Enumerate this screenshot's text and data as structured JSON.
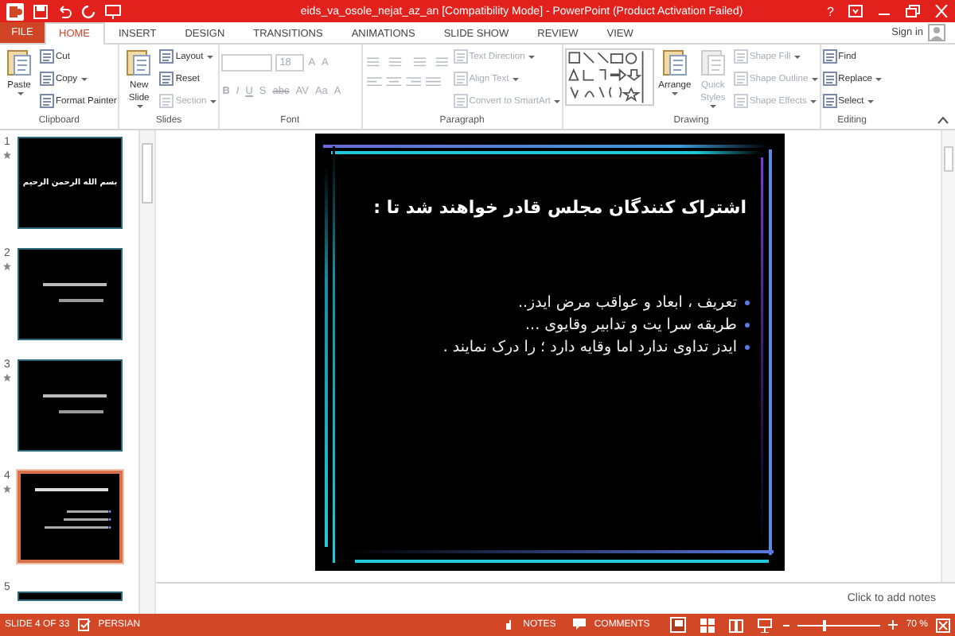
{
  "window": {
    "title": "eids_va_osole_nejat_az_an [Compatibility Mode] - PowerPoint (Product Activation Failed)",
    "help": "?"
  },
  "tabs": [
    {
      "label": "FILE",
      "kind": "file",
      "selected": false
    },
    {
      "label": "HOME",
      "kind": "tab",
      "selected": true
    },
    {
      "label": "INSERT",
      "kind": "tab",
      "selected": false
    },
    {
      "label": "DESIGN",
      "kind": "tab",
      "selected": false
    },
    {
      "label": "TRANSITIONS",
      "kind": "tab",
      "selected": false
    },
    {
      "label": "ANIMATIONS",
      "kind": "tab",
      "selected": false
    },
    {
      "label": "SLIDE SHOW",
      "kind": "tab",
      "selected": false
    },
    {
      "label": "REVIEW",
      "kind": "tab",
      "selected": false
    },
    {
      "label": "VIEW",
      "kind": "tab",
      "selected": false
    }
  ],
  "sign_in": "Sign in",
  "ribbon": [
    {
      "label": "Clipboard",
      "cols": [
        [
          {
            "kind": "large",
            "label": "Paste",
            "caret": true,
            "disabled": false
          }
        ],
        [
          {
            "kind": "small",
            "label": "Cut",
            "caret": false,
            "disabled": false
          },
          {
            "kind": "small",
            "label": "Copy",
            "caret": true,
            "disabled": false
          },
          {
            "kind": "small",
            "label": "Format Painter",
            "caret": false,
            "disabled": false
          }
        ]
      ]
    },
    {
      "label": "Slides",
      "cols": [
        [
          {
            "kind": "large",
            "label": "New Slide",
            "caret": true,
            "disabled": false
          }
        ],
        [
          {
            "kind": "small",
            "label": "Layout",
            "caret": true,
            "disabled": false
          },
          {
            "kind": "small",
            "label": "Reset",
            "caret": false,
            "disabled": false
          },
          {
            "kind": "small",
            "label": "Section",
            "caret": true,
            "disabled": true
          }
        ]
      ]
    },
    {
      "label": "Font",
      "cols": [
        [
          {
            "kind": "fields",
            "size": "18",
            "glyphs": [
              "A",
              "A"
            ],
            "disabled": true
          },
          {
            "kind": "glyphs",
            "glyphs": [
              "B",
              "I",
              "U",
              "S",
              "abc",
              "AV",
              "Aa",
              "A"
            ],
            "disabled": true
          }
        ]
      ]
    },
    {
      "label": "Paragraph",
      "cols": [
        [
          {
            "kind": "tools",
            "disabled": true
          }
        ],
        [
          {
            "kind": "small",
            "label": "Text Direction",
            "caret": true,
            "disabled": true
          },
          {
            "kind": "small",
            "label": "Align Text",
            "caret": true,
            "disabled": true
          },
          {
            "kind": "small",
            "label": "Convert to SmartArt",
            "caret": true,
            "disabled": true
          }
        ]
      ]
    },
    {
      "label": "Drawing",
      "cols": [
        [
          {
            "kind": "gallery"
          }
        ],
        [
          {
            "kind": "large",
            "label": "Arrange",
            "caret": true,
            "disabled": false
          }
        ],
        [
          {
            "kind": "large",
            "label": "Quick Styles",
            "caret": true,
            "disabled": true
          }
        ],
        [
          {
            "kind": "small",
            "label": "Shape Fill",
            "caret": true,
            "disabled": true
          },
          {
            "kind": "small",
            "label": "Shape Outline",
            "caret": true,
            "disabled": true
          },
          {
            "kind": "small",
            "label": "Shape Effects",
            "caret": true,
            "disabled": true
          }
        ]
      ]
    },
    {
      "label": "Editing",
      "cols": [
        [
          {
            "kind": "small",
            "label": "Find",
            "caret": false,
            "disabled": false
          },
          {
            "kind": "small",
            "label": "Replace",
            "caret": true,
            "disabled": false
          },
          {
            "kind": "small",
            "label": "Select",
            "caret": true,
            "disabled": false
          }
        ]
      ]
    }
  ],
  "thumbnails": [
    {
      "number": "1",
      "kind": "text",
      "selected": false,
      "lines": [
        "بسم الله الرحمن الرحيم"
      ]
    },
    {
      "number": "2",
      "kind": "blurred",
      "selected": false
    },
    {
      "number": "3",
      "kind": "blurred",
      "selected": false
    },
    {
      "number": "4",
      "kind": "slide",
      "selected": true
    },
    {
      "number": "5",
      "kind": "cut",
      "selected": false
    }
  ],
  "slide": {
    "title": "اشتراک کنندگان مجلس قادر خواهند شد تا :",
    "bullets": [
      "تعریف ، ابعاد و عواقب مرض ایدز..",
      "طریقه سرا یت و تدابیر وقایوی ...",
      "ایدز تداوی ندارد اما وقایه دارد ؛ را درک نمایند ."
    ]
  },
  "notes": {
    "placeholder": "Click to add notes"
  },
  "status_bar": {
    "slide": "SLIDE 4 OF 33",
    "language": "PERSIAN",
    "notes": "NOTES",
    "comments": "COMMENTS",
    "zoom": "70 %",
    "zoom_slider": {
      "level": 0.3
    }
  }
}
